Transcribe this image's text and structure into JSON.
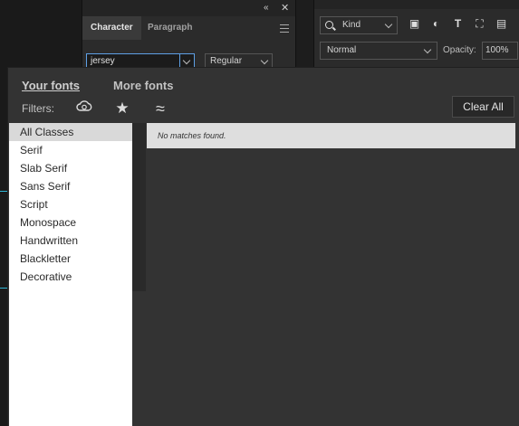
{
  "character_panel": {
    "tabs": [
      {
        "label": "Character",
        "active": true
      },
      {
        "label": "Paragraph",
        "active": false
      }
    ],
    "font_search_value": "jersey",
    "font_style_value": "Regular"
  },
  "layers_panel": {
    "filter_kind": "Kind",
    "blend_mode": "Normal",
    "opacity_label": "Opacity:",
    "opacity_value": "100%",
    "filter_icons": [
      "image-icon",
      "adjustment-icon",
      "type-icon",
      "shape-icon",
      "smart-object-icon"
    ]
  },
  "font_popup": {
    "your_fonts_label": "Your fonts",
    "more_fonts_label": "More fonts",
    "filters_label": "Filters:",
    "clear_all_label": "Clear All",
    "filter_icons": [
      "creative-cloud-icon",
      "star-icon",
      "similar-icon"
    ],
    "classes": [
      {
        "label": "All Classes",
        "selected": true
      },
      {
        "label": "Serif",
        "selected": false
      },
      {
        "label": "Slab Serif",
        "selected": false
      },
      {
        "label": "Sans Serif",
        "selected": false
      },
      {
        "label": "Script",
        "selected": false
      },
      {
        "label": "Monospace",
        "selected": false
      },
      {
        "label": "Handwritten",
        "selected": false
      },
      {
        "label": "Blackletter",
        "selected": false
      },
      {
        "label": "Decorative",
        "selected": false
      }
    ],
    "no_matches_text": "No matches found."
  },
  "colors": {
    "accent_focus": "#5ea0e5",
    "guide": "#2fb7d6"
  }
}
